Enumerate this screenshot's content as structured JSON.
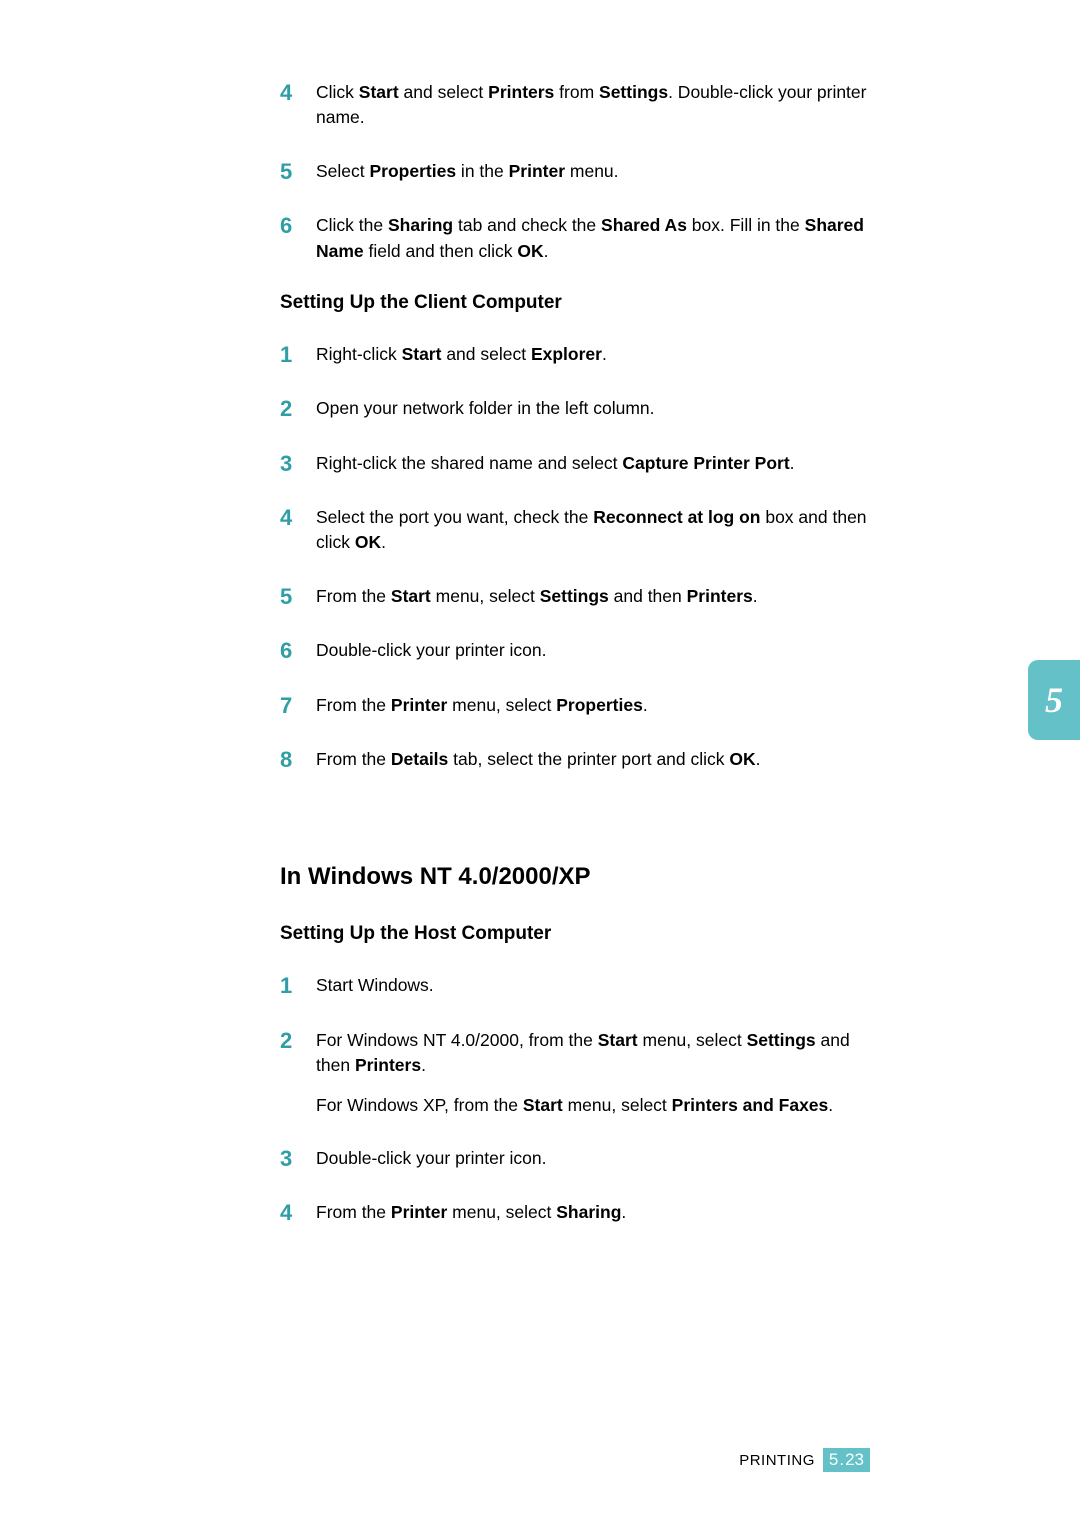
{
  "topSteps": [
    {
      "num": "4",
      "html": "Click <b>Start</b> and select <b>Printers</b> from <b>Settings</b>. Double-click your printer name."
    },
    {
      "num": "5",
      "html": "Select <b>Properties</b> in the <b>Printer</b> menu."
    },
    {
      "num": "6",
      "html": "Click the <b>Sharing</b> tab and check the <b>Shared As</b> box. Fill in the <b>Shared Name</b> field and then click <b>OK</b>."
    }
  ],
  "clientHeading": "Setting Up the Client Computer",
  "clientSteps": [
    {
      "num": "1",
      "html": "Right-click <b>Start</b> and select <b>Explorer</b>."
    },
    {
      "num": "2",
      "html": "Open your network folder in the left column."
    },
    {
      "num": "3",
      "html": "Right-click the shared name and select <b>Capture Printer Port</b>."
    },
    {
      "num": "4",
      "html": "Select the port you want, check the <b>Reconnect at log on</b> box and then click <b>OK</b>."
    },
    {
      "num": "5",
      "html": "From the <b>Start</b> menu, select <b>Settings</b> and then <b>Printers</b>."
    },
    {
      "num": "6",
      "html": "Double-click your printer icon."
    },
    {
      "num": "7",
      "html": "From the <b>Printer</b> menu, select <b>Properties</b>."
    },
    {
      "num": "8",
      "html": "From the <b>Details</b> tab, select the printer port and click <b>OK</b>."
    }
  ],
  "sectionHeading": "In Windows NT 4.0/2000/XP",
  "hostHeading": "Setting Up the Host Computer",
  "hostSteps": [
    {
      "num": "1",
      "html": "Start Windows."
    },
    {
      "num": "2",
      "html": "For Windows NT 4.0/2000, from the <b>Start</b> menu, select <b>Settings</b> and then <b>Printers</b>.<div class=\"paragap\"></div>For Windows XP, from the <b>Start</b> menu, select <b>Printers and Faxes</b>."
    },
    {
      "num": "3",
      "html": "Double-click your printer icon."
    },
    {
      "num": "4",
      "html": "From the <b>Printer</b> menu, select <b>Sharing</b>."
    }
  ],
  "sideTab": "5",
  "footerLabel": "PRINTING",
  "pageChapter": "5",
  "pageNumber": "23"
}
